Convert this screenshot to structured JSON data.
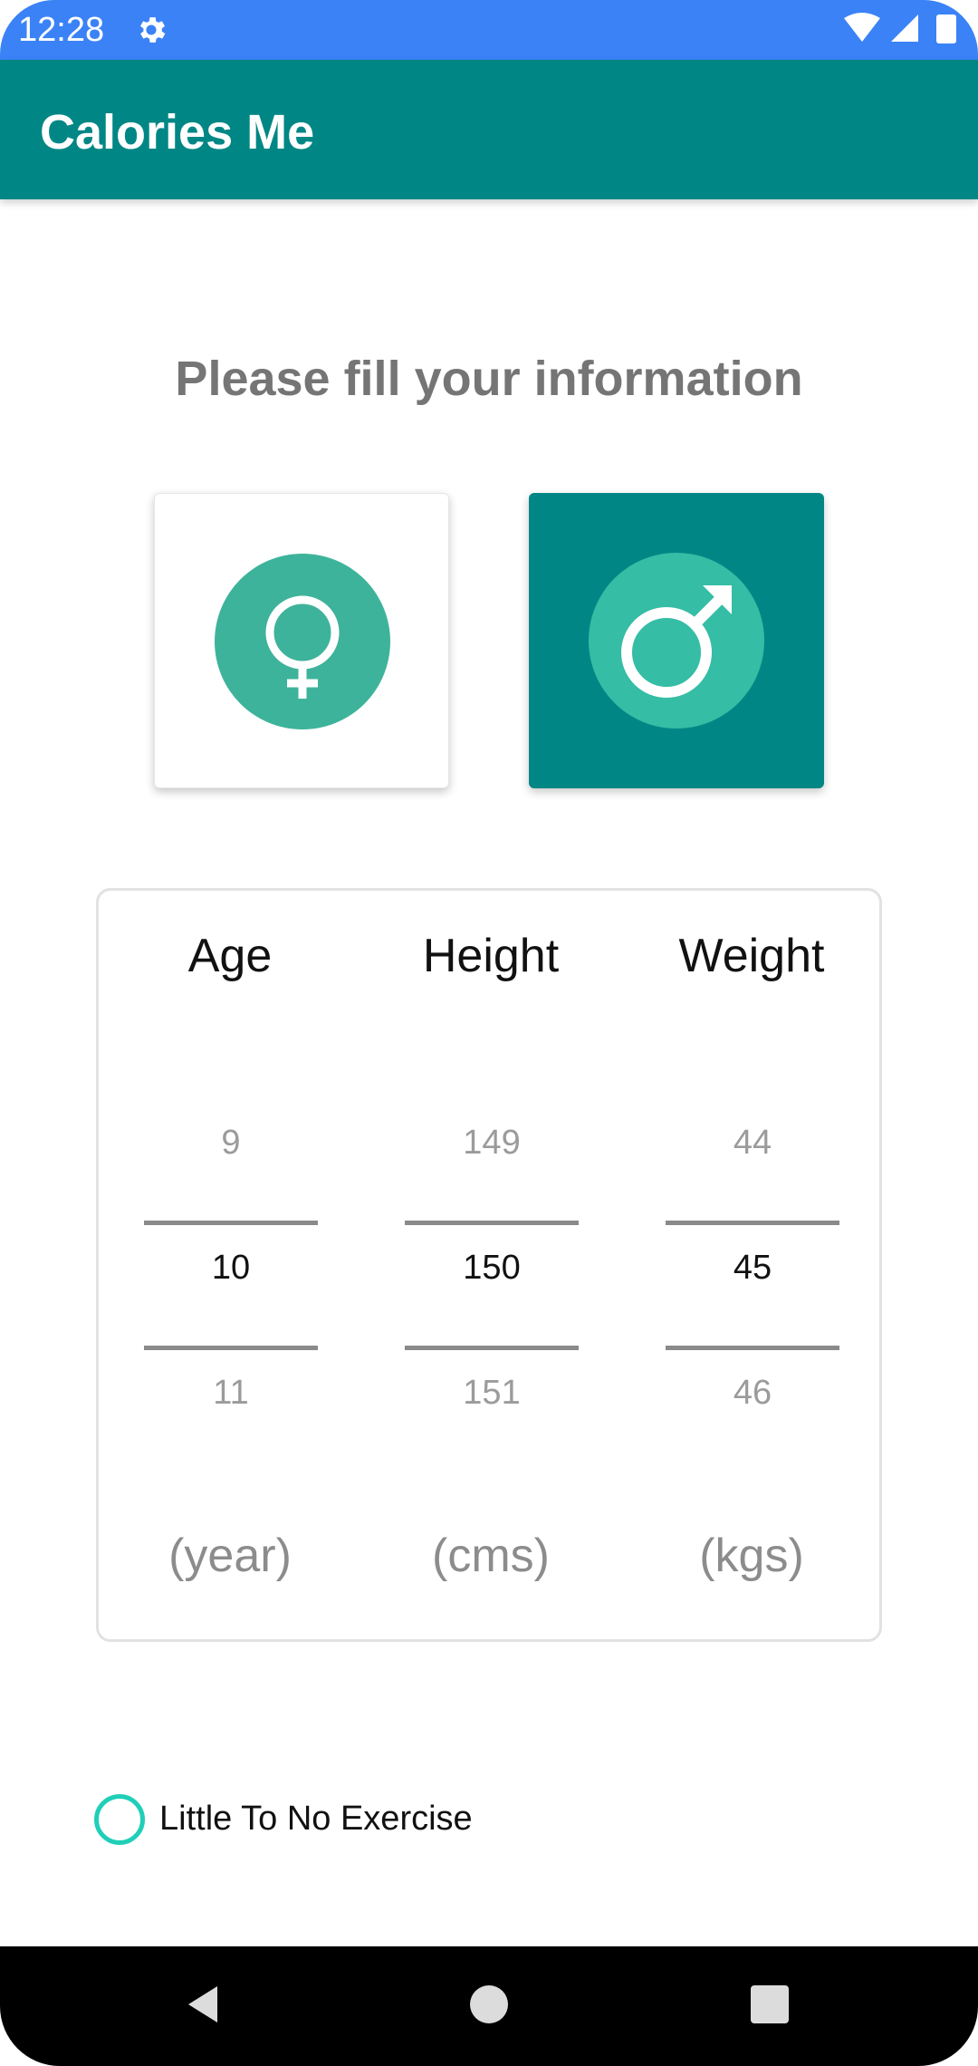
{
  "status_bar": {
    "time": "12:28",
    "icons": [
      "gear-icon",
      "wifi-icon",
      "signal-icon",
      "battery-icon"
    ]
  },
  "app_bar": {
    "title": "Calories Me",
    "color": "#008785"
  },
  "heading": "Please fill your information",
  "gender": {
    "options": [
      {
        "name": "female",
        "icon": "female-symbol-icon",
        "selected": false
      },
      {
        "name": "male",
        "icon": "male-symbol-icon",
        "selected": true
      }
    ]
  },
  "measurements": [
    {
      "label": "Age",
      "prev": "9",
      "value": "10",
      "next": "11",
      "unit": "(year)"
    },
    {
      "label": "Height",
      "prev": "149",
      "value": "150",
      "next": "151",
      "unit": "(cms)"
    },
    {
      "label": "Weight",
      "prev": "44",
      "value": "45",
      "next": "46",
      "unit": "(kgs)"
    }
  ],
  "activity": {
    "label": "Little To No Exercise",
    "selected": false
  },
  "nav_bar": {
    "icons": [
      "back-icon",
      "home-icon",
      "recents-icon"
    ]
  },
  "colors": {
    "status_bar": "#3b82f6",
    "primary": "#008785",
    "accent": "#1fcfb8"
  }
}
